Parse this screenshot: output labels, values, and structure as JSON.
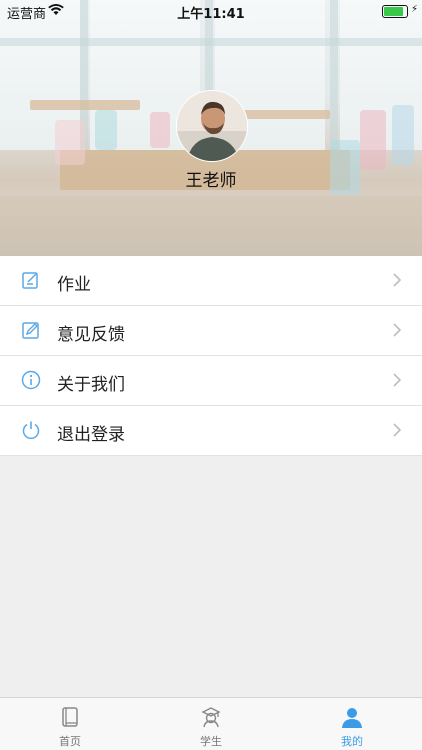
{
  "status_bar": {
    "carrier": "运营商",
    "time": "上午11:41"
  },
  "profile": {
    "name": "王老师"
  },
  "menu": [
    {
      "label": "作业",
      "icon": "edit-square-icon"
    },
    {
      "label": "意见反馈",
      "icon": "feedback-pencil-icon"
    },
    {
      "label": "关于我们",
      "icon": "info-icon"
    },
    {
      "label": "退出登录",
      "icon": "power-icon"
    }
  ],
  "tabbar": [
    {
      "label": "首页",
      "icon": "book-icon",
      "active": false
    },
    {
      "label": "学生",
      "icon": "student-icon",
      "active": false
    },
    {
      "label": "我的",
      "icon": "person-icon",
      "active": true
    }
  ],
  "colors": {
    "accent": "#3c9be6",
    "menu_icon": "#5aa9e6",
    "background": "#efefef"
  }
}
